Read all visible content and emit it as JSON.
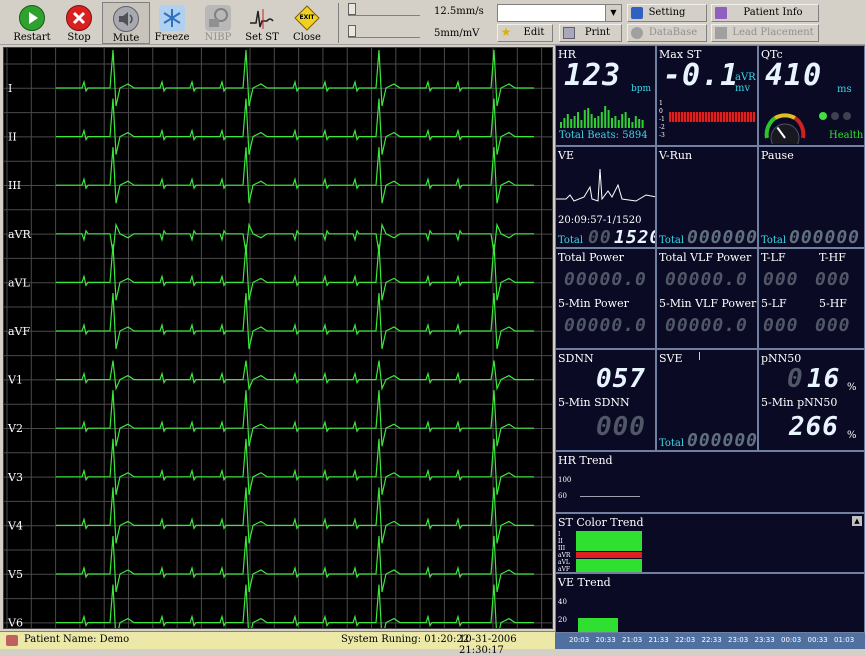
{
  "toolbar": {
    "buttons": [
      {
        "label": "Restart",
        "icon": "play-icon"
      },
      {
        "label": "Stop",
        "icon": "stop-icon"
      },
      {
        "label": "Mute",
        "icon": "speaker-mute-icon"
      },
      {
        "label": "Freeze",
        "icon": "snowflake-icon"
      },
      {
        "label": "NIBP",
        "icon": "bp-cuff-icon"
      },
      {
        "label": "Set ST",
        "icon": "st-segment-icon"
      },
      {
        "label": "Close",
        "icon": "exit-sign-icon"
      }
    ],
    "exit_sign": "EXIT",
    "speed_label": "12.5mm/s",
    "gain_label": "5mm/mV",
    "combo_value": "",
    "edit_label": "Edit",
    "print_label": "Print",
    "setting_label": "Setting",
    "patient_info_label": "Patient Info",
    "database_label": "DataBase",
    "lead_placement_label": "Lead Placement"
  },
  "leads": [
    "I",
    "II",
    "III",
    "aVR",
    "aVL",
    "aVF",
    "V1",
    "V2",
    "V3",
    "V4",
    "V5",
    "V6"
  ],
  "ecg_colors": {
    "bg": "#000000",
    "grid": "#4a4a4a",
    "trace": "#3ce83c"
  },
  "status": {
    "patient": "Patient Name: Demo",
    "running": "System Runing: 01:20:22",
    "datetime": "10-31-2006  21:30:17"
  },
  "panel": {
    "hr": {
      "title": "HR",
      "value": "123",
      "unit": "bpm",
      "total_beats": "Total Beats: 5894"
    },
    "maxst": {
      "title": "Max ST",
      "value": "-0.1",
      "lead": "aVR",
      "unit": "mv",
      "scale": [
        "1",
        "0",
        "-1",
        "-2",
        "-3"
      ]
    },
    "qtc": {
      "title": "QTc",
      "value": "410",
      "unit": "ms",
      "status": "Health",
      "gauge_fraction": 0.3
    },
    "ve": {
      "title": "VE",
      "time": "20:09:57-1/1520",
      "total_label": "Total",
      "total_dim": "00",
      "total_value": "1520"
    },
    "vrun": {
      "title": "V-Run",
      "total_label": "Total",
      "total_value": "000000"
    },
    "pause": {
      "title": "Pause",
      "total_label": "Total",
      "total_value": "000000"
    },
    "total_power": {
      "title": "Total Power",
      "value": "00000.0"
    },
    "total_vlf": {
      "title": "Total VLF Power",
      "value": "00000.0"
    },
    "tlf": {
      "title": "T-LF",
      "value": "000"
    },
    "thf": {
      "title": "T-HF",
      "value": "000"
    },
    "min_power": {
      "title": "5-Min Power",
      "value": "00000.0"
    },
    "min_vlf": {
      "title": "5-Min VLF Power",
      "value": "00000.0"
    },
    "lf": {
      "title": "5-LF",
      "value": "000"
    },
    "hf": {
      "title": "5-HF",
      "value": "000"
    },
    "sdnn": {
      "title": "SDNN",
      "value": "057",
      "min_title": "5-Min SDNN",
      "min_value": "000"
    },
    "sve": {
      "title": "SVE",
      "total_label": "Total",
      "total_value": "000000"
    },
    "pnn50": {
      "title": "pNN50",
      "dim": "0",
      "value": "16",
      "unit": "%",
      "min_title": "5-Min pNN50",
      "min_value": "266",
      "min_unit": "%"
    },
    "hr_trend": {
      "title": "HR Trend",
      "ticks": [
        "100",
        "60"
      ]
    },
    "st_trend": {
      "title": "ST Color Trend",
      "leads": [
        "I",
        "II",
        "III",
        "aVR",
        "aVL",
        "aVF"
      ]
    },
    "ve_trend": {
      "title": "VE Trend",
      "ticks": [
        "40",
        "20"
      ]
    },
    "time_axis": [
      "20:03",
      "20:33",
      "21:03",
      "21:33",
      "22:03",
      "22:33",
      "23:03",
      "23:33",
      "00:03",
      "00:33",
      "01:03"
    ]
  }
}
